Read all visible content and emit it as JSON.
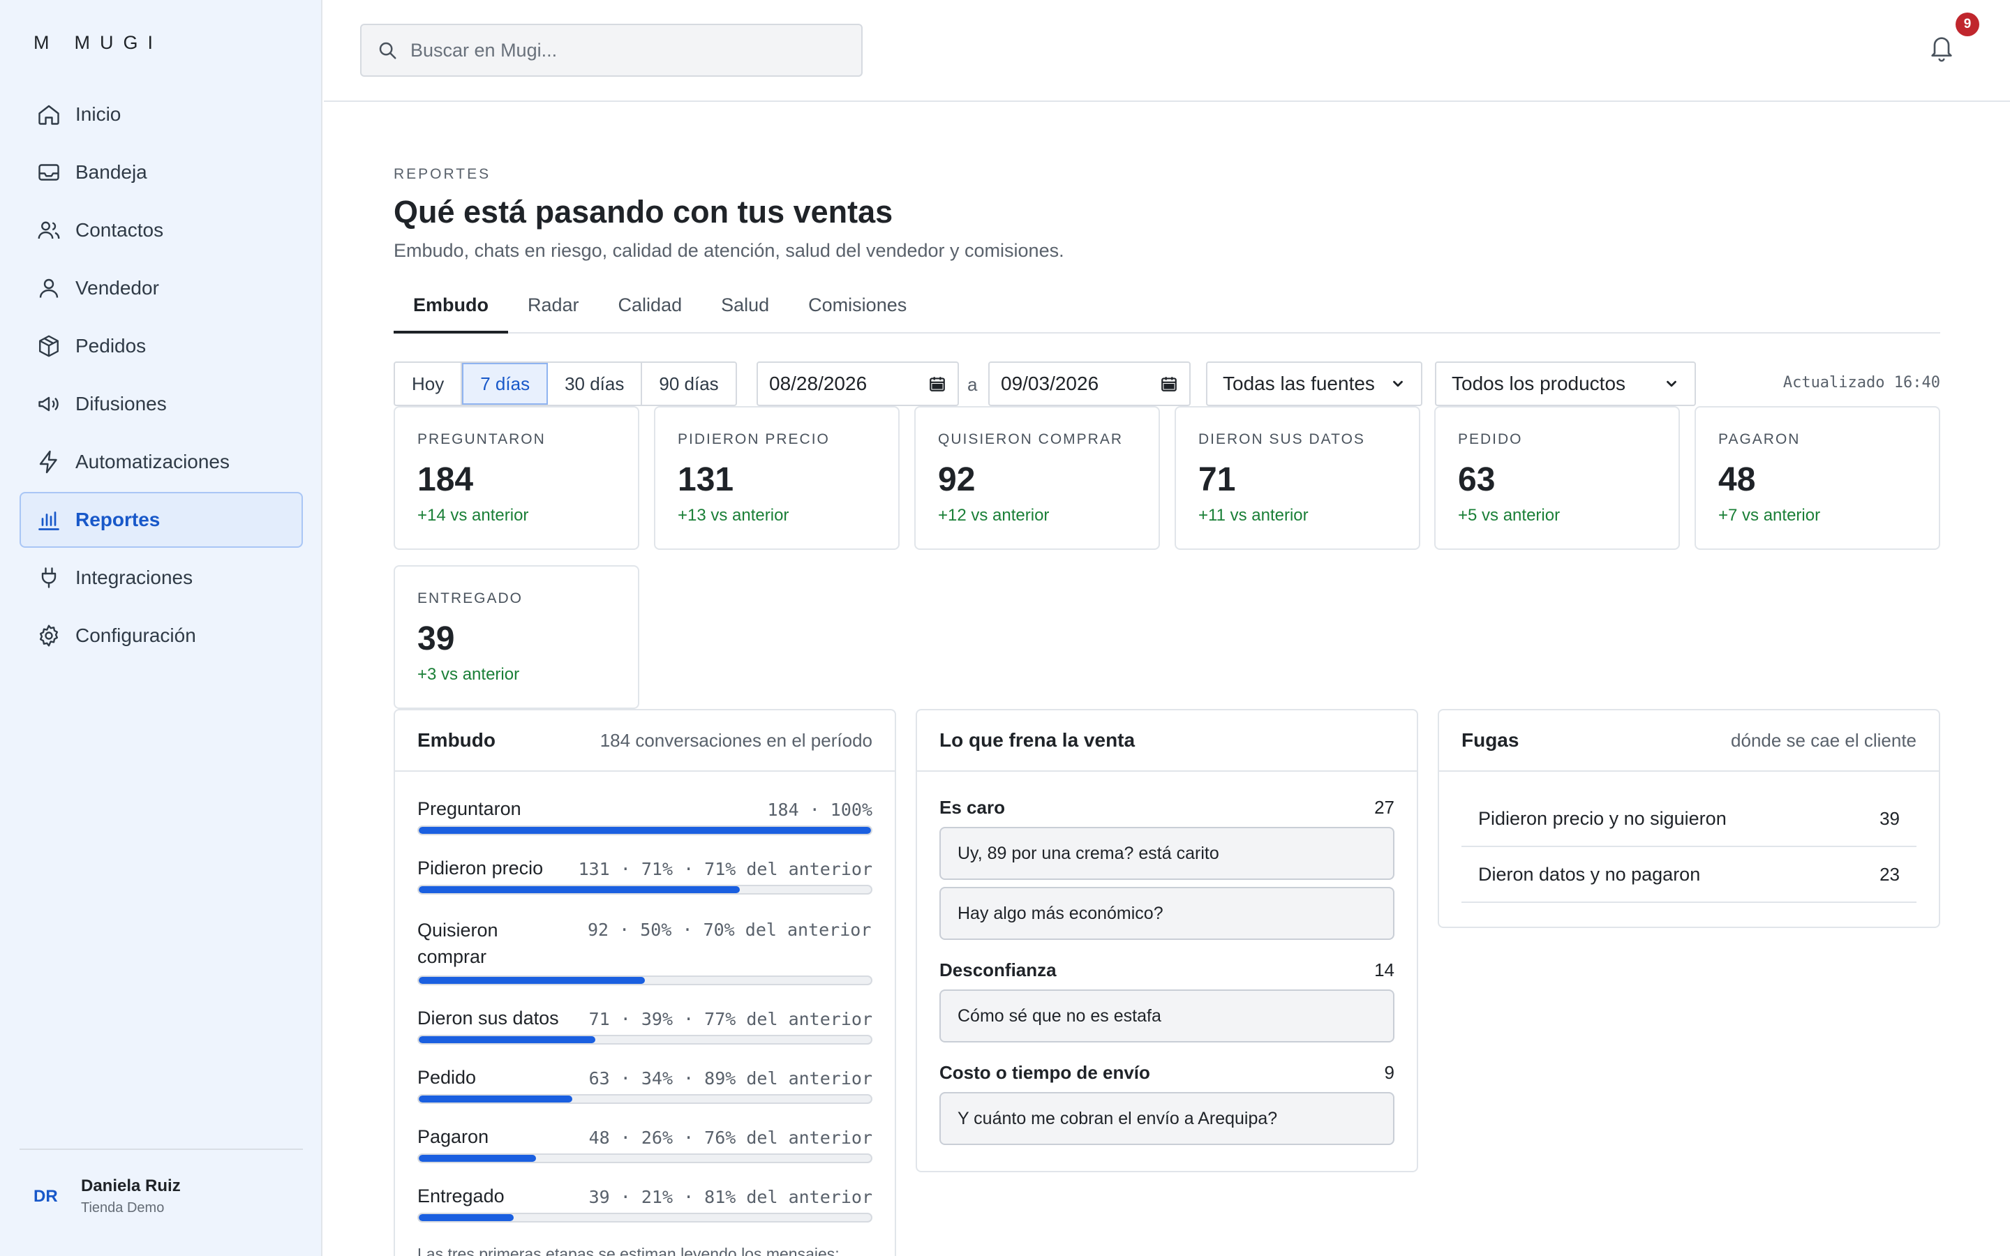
{
  "brand": {
    "mark": "M",
    "name": "MUGI"
  },
  "sidebar": {
    "items": [
      {
        "label": "Inicio",
        "icon": "home-icon"
      },
      {
        "label": "Bandeja",
        "icon": "inbox-icon"
      },
      {
        "label": "Contactos",
        "icon": "users-icon"
      },
      {
        "label": "Vendedor",
        "icon": "user-icon"
      },
      {
        "label": "Pedidos",
        "icon": "box-icon"
      },
      {
        "label": "Difusiones",
        "icon": "megaphone-icon"
      },
      {
        "label": "Automatizaciones",
        "icon": "bolt-icon"
      },
      {
        "label": "Reportes",
        "icon": "bar-chart-icon",
        "active": true
      },
      {
        "label": "Integraciones",
        "icon": "plug-icon"
      },
      {
        "label": "Configuración",
        "icon": "gear-icon"
      }
    ],
    "user": {
      "initials": "DR",
      "name": "Daniela Ruiz",
      "store": "Tienda Demo"
    }
  },
  "topbar": {
    "search_placeholder": "Buscar en Mugi...",
    "notifications_count": "9"
  },
  "header": {
    "eyebrow": "REPORTES",
    "title": "Qué está pasando con tus ventas",
    "subtitle": "Embudo, chats en riesgo, calidad de atención, salud del vendedor y comisiones."
  },
  "tabs": [
    "Embudo",
    "Radar",
    "Calidad",
    "Salud",
    "Comisiones"
  ],
  "filters": {
    "ranges": [
      "Hoy",
      "7 días",
      "30 días",
      "90 días"
    ],
    "active_range": "7 días",
    "date_from": "08/28/2026",
    "date_separator": "a",
    "date_to": "09/03/2026",
    "source": "Todas las fuentes",
    "product": "Todos los productos",
    "updated": "Actualizado 16:40"
  },
  "kpis": [
    {
      "label": "PREGUNTARON",
      "value": "184",
      "delta": "+14 vs anterior"
    },
    {
      "label": "PIDIERON PRECIO",
      "value": "131",
      "delta": "+13 vs anterior"
    },
    {
      "label": "QUISIERON COMPRAR",
      "value": "92",
      "delta": "+12 vs anterior"
    },
    {
      "label": "DIERON SUS DATOS",
      "value": "71",
      "delta": "+11 vs anterior"
    },
    {
      "label": "PEDIDO",
      "value": "63",
      "delta": "+5 vs anterior"
    },
    {
      "label": "PAGARON",
      "value": "48",
      "delta": "+7 vs anterior"
    },
    {
      "label": "ENTREGADO",
      "value": "39",
      "delta": "+3 vs anterior"
    }
  ],
  "funnel": {
    "title": "Embudo",
    "note": "184 conversaciones en el período",
    "rows": [
      {
        "label": "Preguntaron",
        "values": "184 · 100%",
        "fill": 1.0
      },
      {
        "label": "Pidieron precio",
        "values": "131 · 71% · 71% del anterior",
        "fill": 0.71
      },
      {
        "label": "Quisieron comprar",
        "values": "92 · 50% · 70% del anterior",
        "fill": 0.5
      },
      {
        "label": "Dieron sus datos",
        "values": "71 · 39% · 77% del anterior",
        "fill": 0.39
      },
      {
        "label": "Pedido",
        "values": "63 · 34% · 89% del anterior",
        "fill": 0.34
      },
      {
        "label": "Pagaron",
        "values": "48 · 26% · 76% del anterior",
        "fill": 0.26
      },
      {
        "label": "Entregado",
        "values": "39 · 21% · 81% del anterior",
        "fill": 0.21
      }
    ],
    "footnote": "Las tres primeras etapas se estiman leyendo los mensajes;"
  },
  "blockers": {
    "title": "Lo que frena la venta",
    "groups": [
      {
        "title": "Es caro",
        "count": "27",
        "quotes": [
          "Uy, 89 por una crema? está carito",
          "Hay algo más económico?"
        ]
      },
      {
        "title": "Desconfianza",
        "count": "14",
        "quotes": [
          "Cómo sé que no es estafa"
        ]
      },
      {
        "title": "Costo o tiempo de envío",
        "count": "9",
        "quotes": [
          "Y cuánto me cobran el envío a Arequipa?"
        ]
      }
    ]
  },
  "leaks": {
    "title": "Fugas",
    "note": "dónde se cae el cliente",
    "items": [
      {
        "label": "Pidieron precio y no siguieron",
        "count": "39"
      },
      {
        "label": "Dieron datos y no pagaron",
        "count": "23"
      }
    ]
  },
  "colors": {
    "accent": "#1a5fe0",
    "positive": "#1a7f37",
    "badge": "#c0262d",
    "sidebar_bg": "#eef4fd"
  }
}
